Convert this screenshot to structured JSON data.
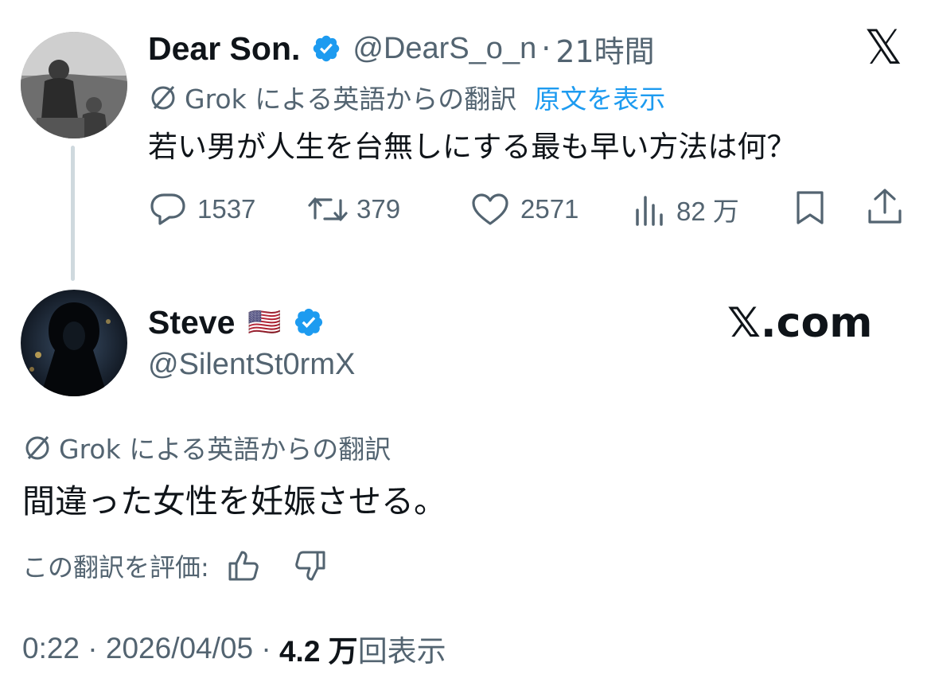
{
  "top_tweet": {
    "display_name": "Dear Son.",
    "handle": "@DearS_o_n",
    "separator": "·",
    "time": "21時間",
    "translation_label": "Grok による英語からの翻訳",
    "show_original": "原文を表示",
    "text": "若い男が人生を台無しにする最も早い方法は何？",
    "actions": {
      "replies": "1537",
      "reposts": "379",
      "likes": "2571",
      "views": "82 万"
    }
  },
  "reply_tweet": {
    "display_name": "Steve",
    "flag": "🇺🇸",
    "handle": "@SilentSt0rmX",
    "translation_label": "Grok による英語からの翻訳",
    "text": "間違った女性を妊娠させる。",
    "rate_label": "この翻訳を評価:",
    "timestamp": "0:22 · 2026/04/05 · ",
    "views_count": "4.2 万",
    "views_label": "回表示"
  },
  "watermark": {
    "x_logo": "𝕏",
    "site": "𝕏.com"
  },
  "icons": {
    "verified": "verified-badge-icon",
    "reply": "reply-icon",
    "repost": "repost-icon",
    "like": "heart-icon",
    "views": "views-icon",
    "bookmark": "bookmark-icon",
    "share": "share-icon",
    "translate": "translate-icon",
    "thumb_up": "thumbs-up-icon",
    "thumb_down": "thumbs-down-icon"
  },
  "colors": {
    "accent": "#1d9bf0",
    "text": "#0f1419",
    "muted": "#536471",
    "thread_line": "#cfd9de"
  }
}
